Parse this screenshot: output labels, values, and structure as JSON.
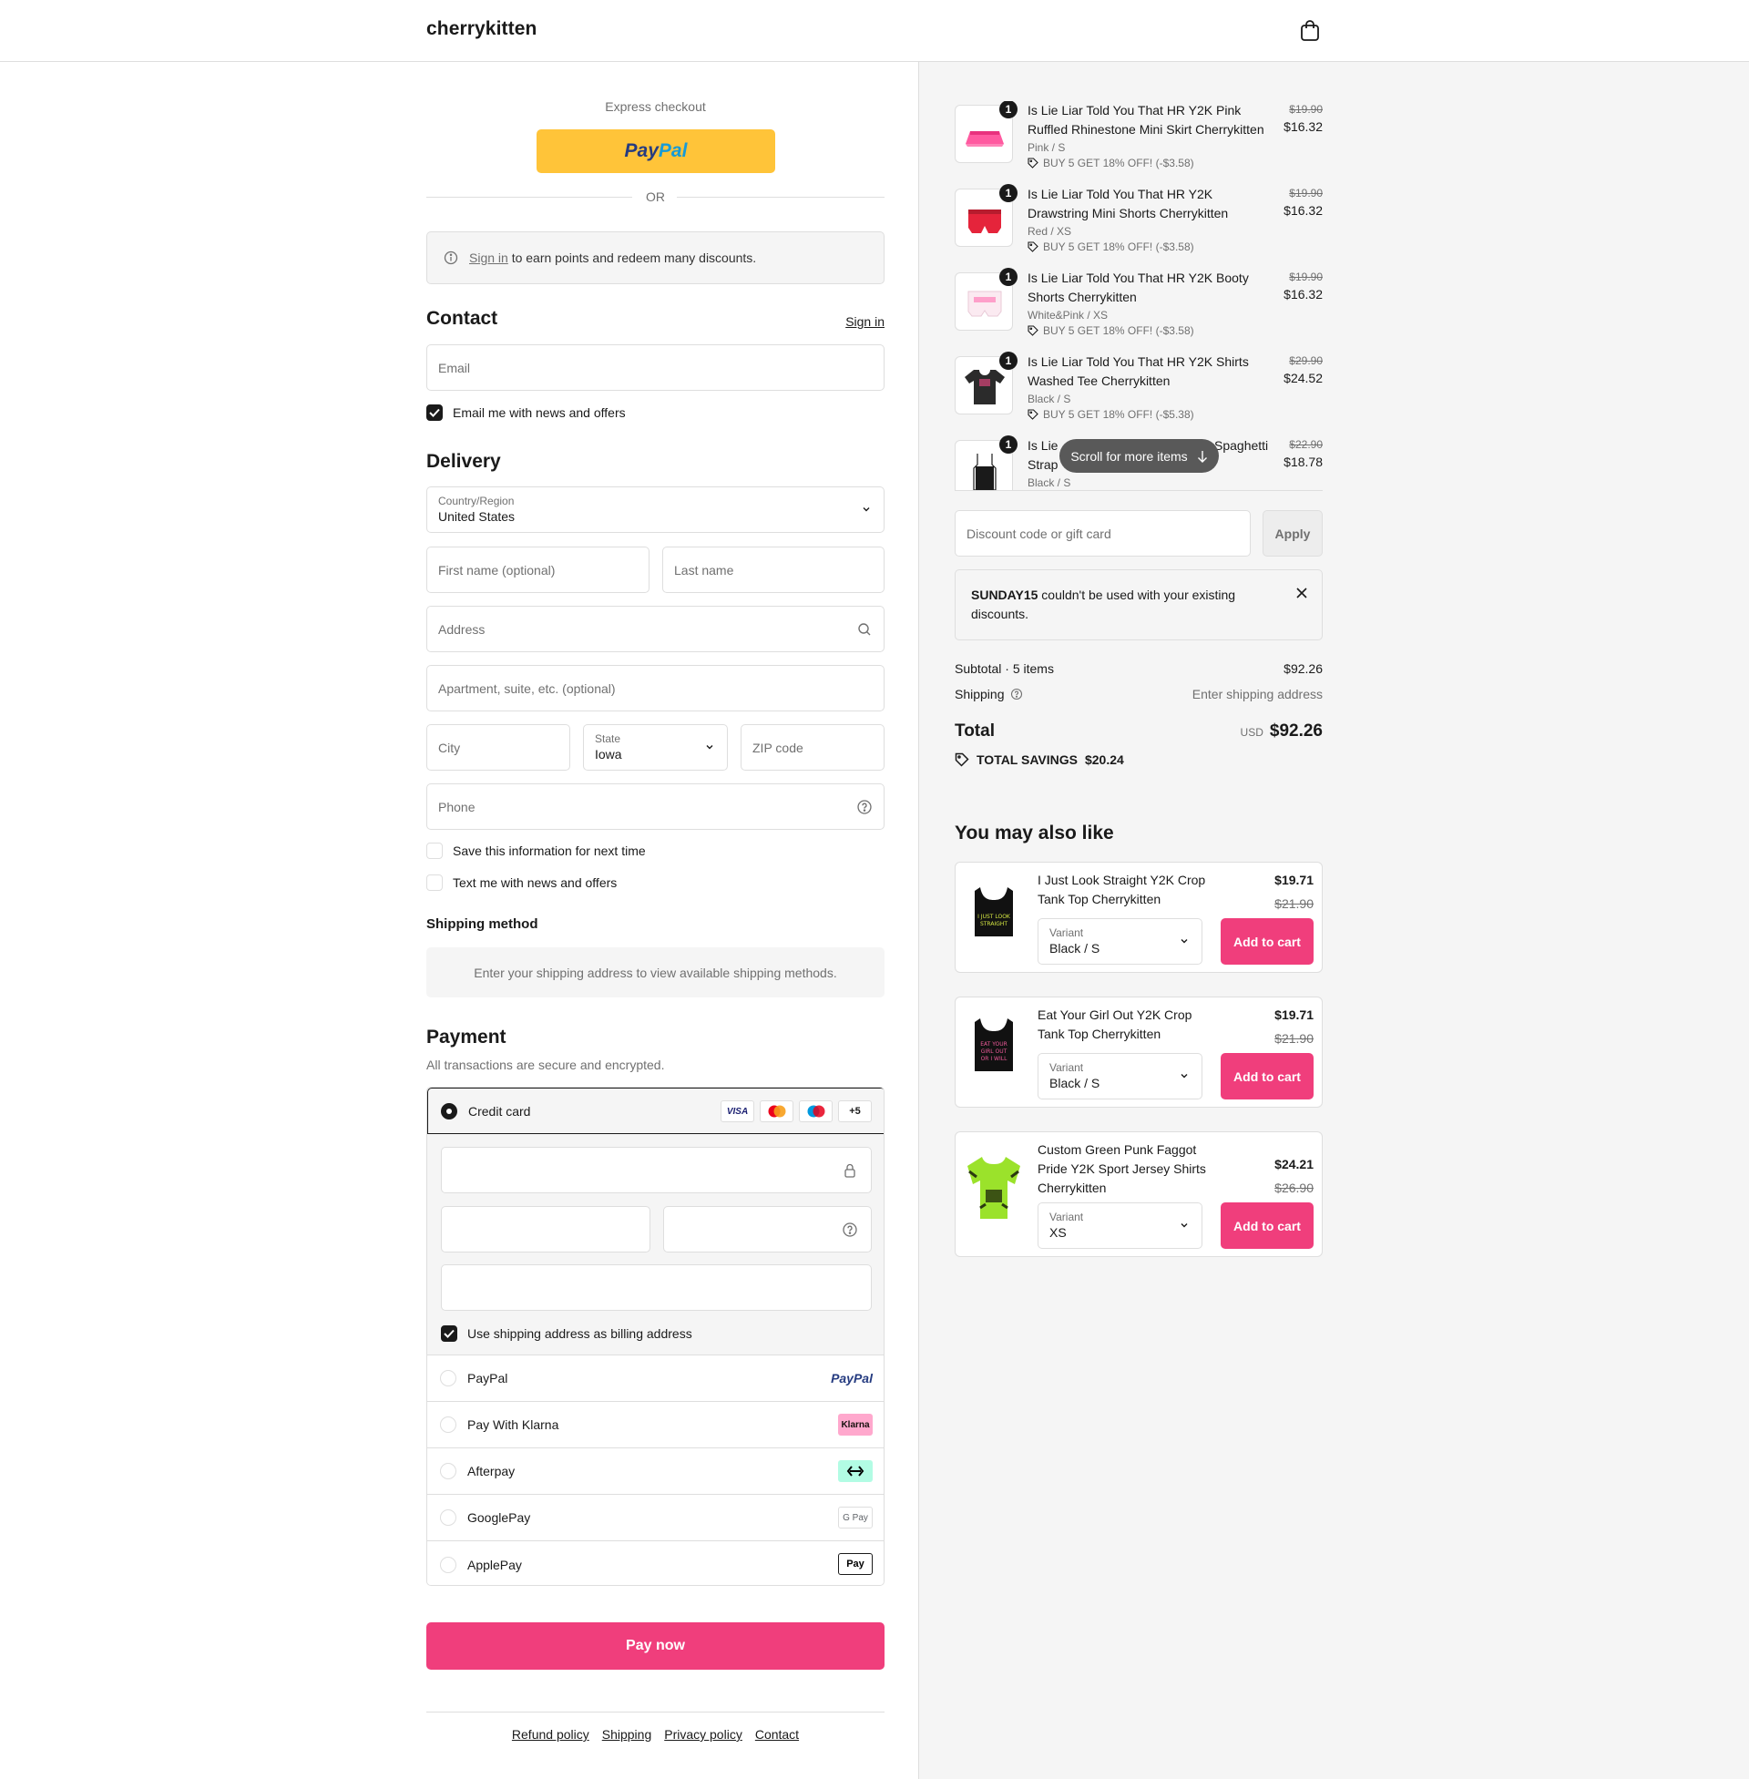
{
  "header": {
    "logo": "cherrykitten",
    "cart_icon": "shopping-bag-icon"
  },
  "express": {
    "label": "Express checkout",
    "paypal_a": "Pay",
    "paypal_b": "Pal",
    "or": "OR"
  },
  "signin_banner": {
    "link": "Sign in",
    "text": " to earn points and redeem many discounts."
  },
  "contact": {
    "title": "Contact",
    "signin": "Sign in",
    "email_placeholder": "Email",
    "news_label": "Email me with news and offers",
    "news_checked": true
  },
  "delivery": {
    "title": "Delivery",
    "country_label": "Country/Region",
    "country_value": "United States",
    "first_name_placeholder": "First name (optional)",
    "last_name_placeholder": "Last name",
    "address_placeholder": "Address",
    "apartment_placeholder": "Apartment, suite, etc. (optional)",
    "city_placeholder": "City",
    "state_label": "State",
    "state_value": "Iowa",
    "zip_placeholder": "ZIP code",
    "phone_placeholder": "Phone",
    "save_info_label": "Save this information for next time",
    "text_me_label": "Text me with news and offers"
  },
  "shipping_method": {
    "title": "Shipping method",
    "message": "Enter your shipping address to view available shipping methods."
  },
  "payment": {
    "title": "Payment",
    "subtitle": "All transactions are secure and encrypted.",
    "credit_card_label": "Credit card",
    "card_logos": [
      "VISA",
      "+5"
    ],
    "billing_label": "Use shipping address as billing address",
    "options": [
      {
        "label": "PayPal",
        "logo": "PayPal"
      },
      {
        "label": "Pay With Klarna",
        "logo": "Klarna"
      },
      {
        "label": "Afterpay",
        "logo": "afterpay-icon"
      },
      {
        "label": "GooglePay",
        "logo": "G Pay"
      },
      {
        "label": "ApplePay",
        "logo": "Pay"
      }
    ],
    "pay_now": "Pay now"
  },
  "footer": {
    "links": [
      "Refund policy",
      "Shipping",
      "Privacy policy",
      "Contact"
    ]
  },
  "order": {
    "items": [
      {
        "qty": "1",
        "name": "Is Lie Liar Told You That HR Y2K Pink Ruffled Rhinestone Mini Skirt Cherrykitten",
        "variant": "Pink / S",
        "discount": "BUY 5 GET 18% OFF! (-$3.58)",
        "old_price": "$19.90",
        "price": "$16.32"
      },
      {
        "qty": "1",
        "name": "Is Lie Liar Told You That HR Y2K Drawstring Mini Shorts Cherrykitten",
        "variant": "Red / XS",
        "discount": "BUY 5 GET 18% OFF! (-$3.58)",
        "old_price": "$19.90",
        "price": "$16.32"
      },
      {
        "qty": "1",
        "name": "Is Lie Liar Told You That HR Y2K Booty Shorts Cherrykitten",
        "variant": "White&Pink / XS",
        "discount": "BUY 5 GET 18% OFF! (-$3.58)",
        "old_price": "$19.90",
        "price": "$16.32"
      },
      {
        "qty": "1",
        "name": "Is Lie Liar Told You That HR Y2K Shirts Washed Tee Cherrykitten",
        "variant": "Black / S",
        "discount": "BUY 5 GET 18% OFF! (-$5.38)",
        "old_price": "$29.90",
        "price": "$24.52"
      },
      {
        "qty": "1",
        "name_a": "Is Lie",
        "name_b": "Spaghetti",
        "name_c": "Strap",
        "variant": "Black / S",
        "old_price": "$22.90",
        "price": "$18.78"
      }
    ],
    "scroll_hint": "Scroll for more items",
    "discount_placeholder": "Discount code or gift card",
    "apply": "Apply",
    "notice_code": "SUNDAY15",
    "notice_text": " couldn't be used with your existing discounts.",
    "subtotal_label": "Subtotal · 5 items",
    "subtotal_value": "$92.26",
    "shipping_label": "Shipping",
    "shipping_value": "Enter shipping address",
    "total_label": "Total",
    "total_currency": "USD",
    "total_value": "$92.26",
    "savings_label": "TOTAL SAVINGS",
    "savings_value": "$20.24"
  },
  "recommendations": {
    "title": "You may also like",
    "items": [
      {
        "name": "I Just Look Straight Y2K Crop Tank Top Cherrykitten",
        "price": "$19.71",
        "old_price": "$21.90",
        "variant_label": "Variant",
        "variant_value": "Black / S",
        "add": "Add to cart"
      },
      {
        "name": "Eat Your Girl Out Y2K Crop Tank Top Cherrykitten",
        "price": "$19.71",
        "old_price": "$21.90",
        "variant_label": "Variant",
        "variant_value": "Black / S",
        "add": "Add to cart"
      },
      {
        "name": "Custom Green Punk Faggot Pride Y2K Sport Jersey Shirts Cherrykitten",
        "price": "$24.21",
        "old_price": "$26.90",
        "variant_label": "Variant",
        "variant_value": "XS",
        "add": "Add to cart"
      }
    ]
  },
  "colors": {
    "accent": "#f03e7c",
    "paypal_yellow": "#ffc439",
    "muted": "#707070",
    "border": "#dedede",
    "panel": "#f5f5f5"
  }
}
